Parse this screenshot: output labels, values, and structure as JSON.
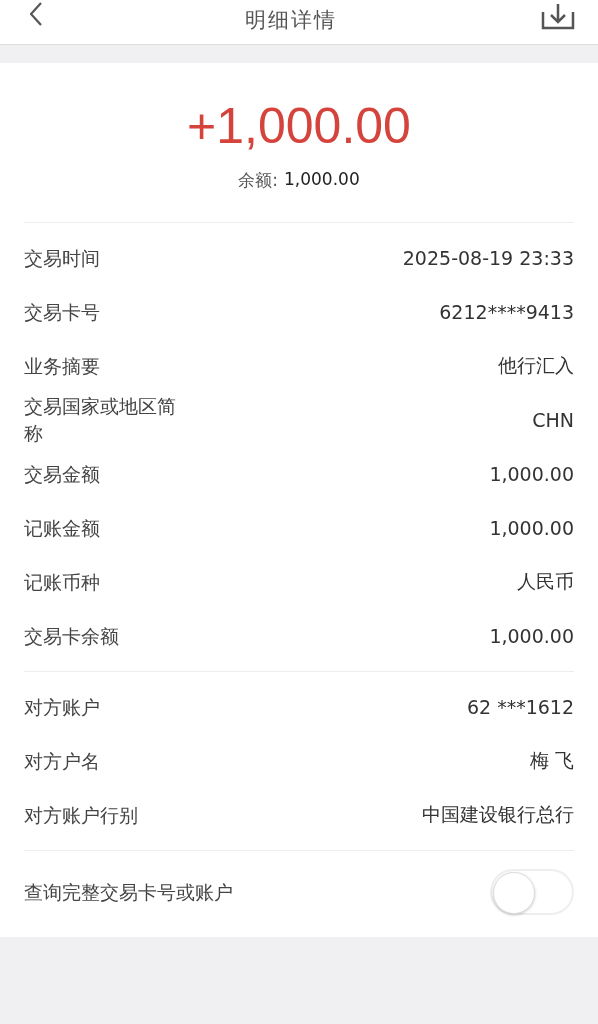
{
  "header": {
    "title": "明细详情"
  },
  "summary": {
    "amount": "+1,000.00",
    "balance_label": "余额:",
    "balance_value": "1,000.00"
  },
  "sections": [
    [
      {
        "label": "交易时间",
        "value": "2025-08-19 23:33"
      },
      {
        "label": "交易卡号",
        "value": "6212****9413"
      },
      {
        "label": "业务摘要",
        "value": "他行汇入"
      },
      {
        "label": "交易国家或地区简称",
        "value": "CHN"
      },
      {
        "label": "交易金额",
        "value": "1,000.00"
      },
      {
        "label": "记账金额",
        "value": "1,000.00"
      },
      {
        "label": "记账币种",
        "value": "人民币"
      },
      {
        "label": "交易卡余额",
        "value": "1,000.00"
      }
    ],
    [
      {
        "label": "对方账户",
        "value": "62 ***1612"
      },
      {
        "label": "对方户名",
        "value": "梅 飞"
      },
      {
        "label": "对方账户行别",
        "value": "中国建设银行总行"
      }
    ]
  ],
  "toggle": {
    "label": "查询完整交易卡号或账户",
    "on": false
  }
}
